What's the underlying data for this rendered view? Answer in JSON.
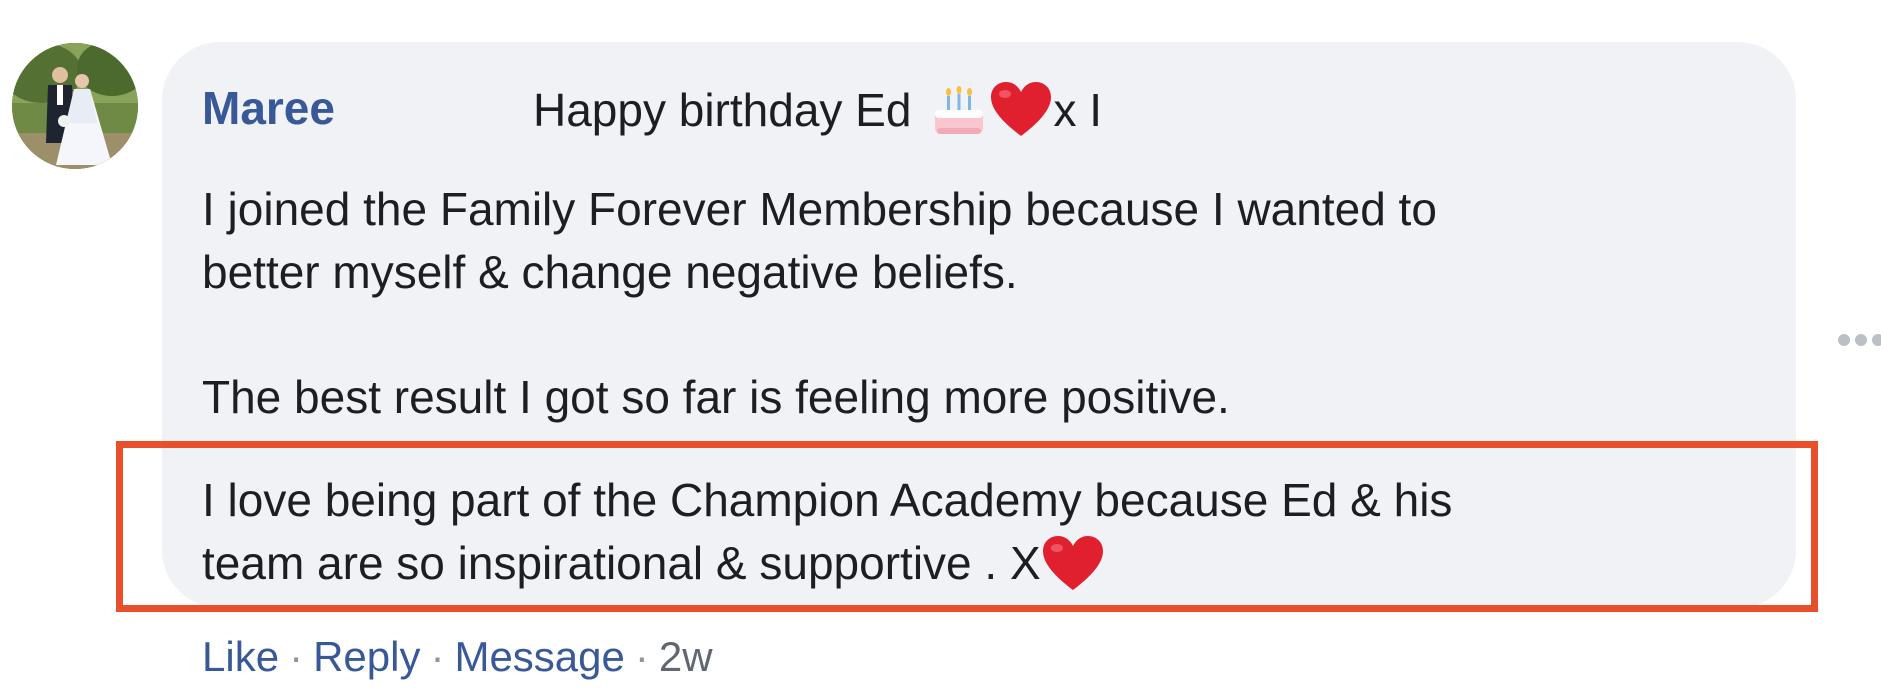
{
  "comment": {
    "author": "Maree",
    "first_line_text": "Happy birthday Ed",
    "first_line_suffix": "x I",
    "paragraph1": [
      "I joined the Family Forever Membership because I wanted to",
      "better myself & change negative beliefs."
    ],
    "paragraph2": "The best result I got so far is feeling more positive.",
    "paragraph3_line1": "I love being part of the Champion Academy because Ed & his",
    "paragraph3_line2": "team are so inspirational & supportive . X",
    "icons": [
      "avatar-photo",
      "birthday-cake-icon",
      "red-heart-icon",
      "more-options-icon"
    ]
  },
  "actions": {
    "like": "Like",
    "reply": "Reply",
    "message": "Message",
    "separator": "·",
    "time": "2w"
  },
  "colors": {
    "author_link": "#385898",
    "bubble_bg": "#f0f2f5",
    "highlight_border": "#e8502b",
    "heart": "#e0202f"
  }
}
